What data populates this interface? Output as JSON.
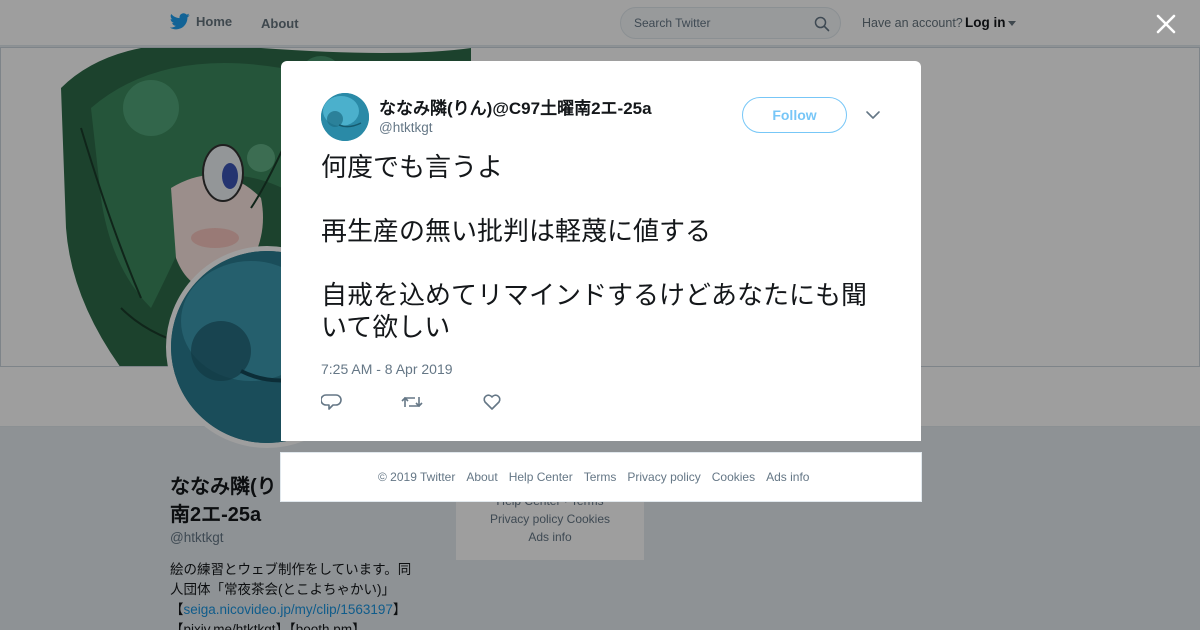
{
  "topbar": {
    "home_label": "Home",
    "about_label": "About",
    "search_placeholder": "Search Twitter",
    "have_account": "Have an account?",
    "login_label": "Log in"
  },
  "profile": {
    "name": "ななみ隣(りん)@C97土曜南2エ-25a",
    "name_visible": "ななみ隣(り",
    "name_line2": "南2エ-25a",
    "handle": "@htktkgt",
    "bio_line1": "絵の練習とウェブ制作をしています。同",
    "bio_line2": "人団体「常夜茶会(とこよちゃかい)」",
    "bio_bracket_open": "【",
    "bio_link1": "seiga.nicovideo.jp/my/clip/1563197",
    "bio_bracket_close": "】",
    "bio_line4": "【pixiv.me/htktkgt】【booth.pm】"
  },
  "bg_footer": {
    "line1": "Help Center · Terms",
    "line2": "Privacy policy    Cookies",
    "line3": "Ads info"
  },
  "tweet": {
    "author_name": "ななみ隣(りん)@C97土曜南2エ-25a",
    "author_handle": "@htktkgt",
    "follow_label": "Follow",
    "paragraphs": [
      "何度でも言うよ",
      "再生産の無い批判は軽蔑に値する",
      "自戒を込めてリマインドするけどあなたにも聞いて欲しい"
    ],
    "timestamp": "7:25 AM - 8 Apr 2019"
  },
  "footer": {
    "copyright": "© 2019 Twitter",
    "about": "About",
    "help": "Help Center",
    "terms": "Terms",
    "privacy": "Privacy policy",
    "cookies": "Cookies",
    "ads": "Ads info"
  },
  "colors": {
    "twitter_blue": "#1da1f2",
    "overlay": "rgba(0,0,0,0.38)",
    "muted_text": "#657786"
  },
  "icons": {
    "logo": "twitter-bird-icon",
    "search": "search-icon",
    "close": "close-icon",
    "reply": "reply-icon",
    "retweet": "retweet-icon",
    "like": "heart-icon",
    "more": "chevron-down-icon"
  }
}
